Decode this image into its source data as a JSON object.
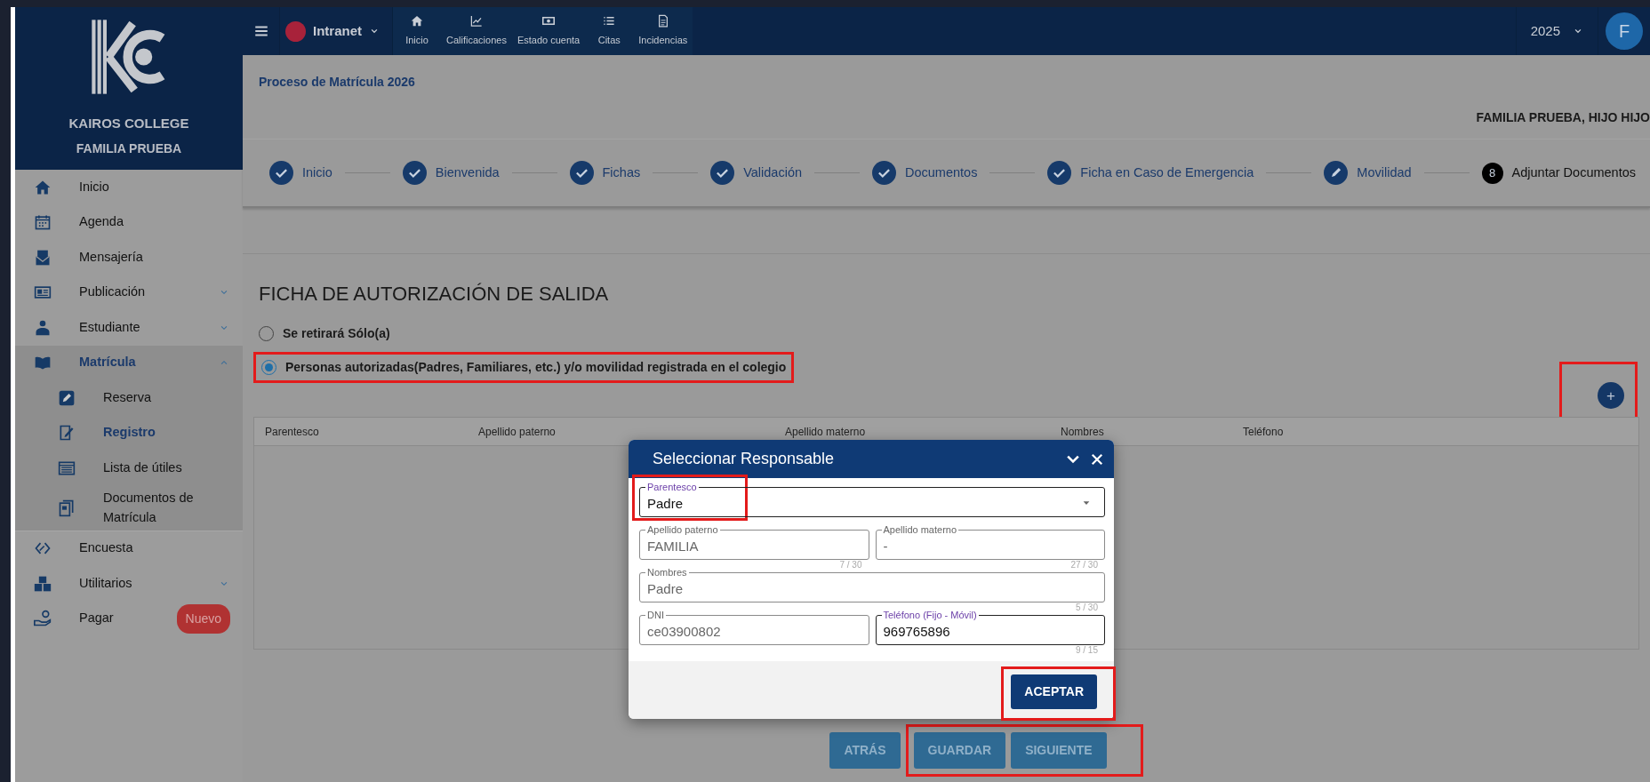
{
  "top_bar": {
    "app": "Intranet",
    "nav": [
      {
        "label": "Inicio"
      },
      {
        "label": "Calificaciones"
      },
      {
        "label": "Estado cuenta"
      },
      {
        "label": "Citas"
      },
      {
        "label": "Incidencias"
      }
    ],
    "year": "2025",
    "avatar": "F"
  },
  "sidebar": {
    "school": "KAIROS COLLEGE",
    "family": "FAMILIA PRUEBA",
    "items": [
      {
        "label": "Inicio",
        "selected": false
      },
      {
        "label": "Agenda",
        "selected": false
      },
      {
        "label": "Mensajería",
        "selected": false
      },
      {
        "label": "Publicación",
        "selected": false,
        "expanded": false
      },
      {
        "label": "Estudiante",
        "selected": false,
        "expanded": false
      },
      {
        "label": "Matrícula",
        "selected": true,
        "expanded": true,
        "children": [
          {
            "label": "Reserva",
            "selected": false
          },
          {
            "label": "Registro",
            "selected": true
          },
          {
            "label": "Lista de útiles",
            "selected": false
          },
          {
            "label": "Documentos de Matrícula",
            "selected": false
          }
        ]
      },
      {
        "label": "Encuesta",
        "selected": false
      },
      {
        "label": "Utilitarios",
        "selected": false,
        "expanded": false
      },
      {
        "label": "Pagar",
        "selected": false,
        "badge": "Nuevo"
      }
    ]
  },
  "page": {
    "title": "Proceso de Matrícula 2026",
    "student": "FAMILIA PRUEBA, HIJO HIJO",
    "steps": [
      {
        "label": "Inicio",
        "kind": "done"
      },
      {
        "label": "Bienvenida",
        "kind": "done"
      },
      {
        "label": "Fichas",
        "kind": "done"
      },
      {
        "label": "Validación",
        "kind": "done"
      },
      {
        "label": "Documentos",
        "kind": "done"
      },
      {
        "label": "Ficha en Caso de Emergencia",
        "kind": "done"
      },
      {
        "label": "Movilidad",
        "kind": "editing"
      },
      {
        "label": "Adjuntar Documentos",
        "kind": "current",
        "number": "8"
      }
    ]
  },
  "form": {
    "title": "FICHA DE AUTORIZACIÓN DE SALIDA",
    "options": [
      {
        "label": "Se retirará Sólo(a)",
        "selected": false,
        "highlighted": false
      },
      {
        "label": "Personas autorizadas(Padres, Familiares, etc.) y/o movilidad registrada en el colegio",
        "selected": true,
        "highlighted": true
      }
    ],
    "add_button": {
      "label": "+",
      "highlighted": true
    },
    "table": {
      "columns": [
        "Parentesco",
        "Apellido paterno",
        "Apellido materno",
        "Nombres",
        "Teléfono"
      ]
    },
    "buttons": [
      {
        "label": "ATRÁS",
        "highlighted": false
      },
      {
        "label": "GUARDAR",
        "highlighted": true
      },
      {
        "label": "SIGUIENTE",
        "highlighted": true
      }
    ]
  },
  "dialog": {
    "title": "Seleccionar Responsable",
    "rows": [
      [
        {
          "kind": "select",
          "label": "Parentesco",
          "value": "Padre",
          "focused": true,
          "disabled": false,
          "highlighted": true
        }
      ],
      [
        {
          "kind": "text",
          "label": "Apellido paterno",
          "value": "FAMILIA",
          "focused": false,
          "disabled": true,
          "counter": "7 / 30"
        },
        {
          "kind": "text",
          "label": "Apellido materno",
          "value": "-",
          "focused": false,
          "disabled": true,
          "counter": "27 / 30"
        }
      ],
      [
        {
          "kind": "text",
          "label": "Nombres",
          "value": "Padre",
          "focused": false,
          "disabled": true,
          "counter": "5 / 30"
        }
      ],
      [
        {
          "kind": "text",
          "label": "DNI",
          "value": "ce03900802",
          "focused": false,
          "disabled": true
        },
        {
          "kind": "text",
          "label": "Teléfono (Fijo - Móvil)",
          "value": "969765896",
          "focused": true,
          "disabled": false,
          "counter": "9 / 15"
        }
      ]
    ],
    "accept": {
      "label": "ACEPTAR",
      "highlighted": true
    }
  }
}
